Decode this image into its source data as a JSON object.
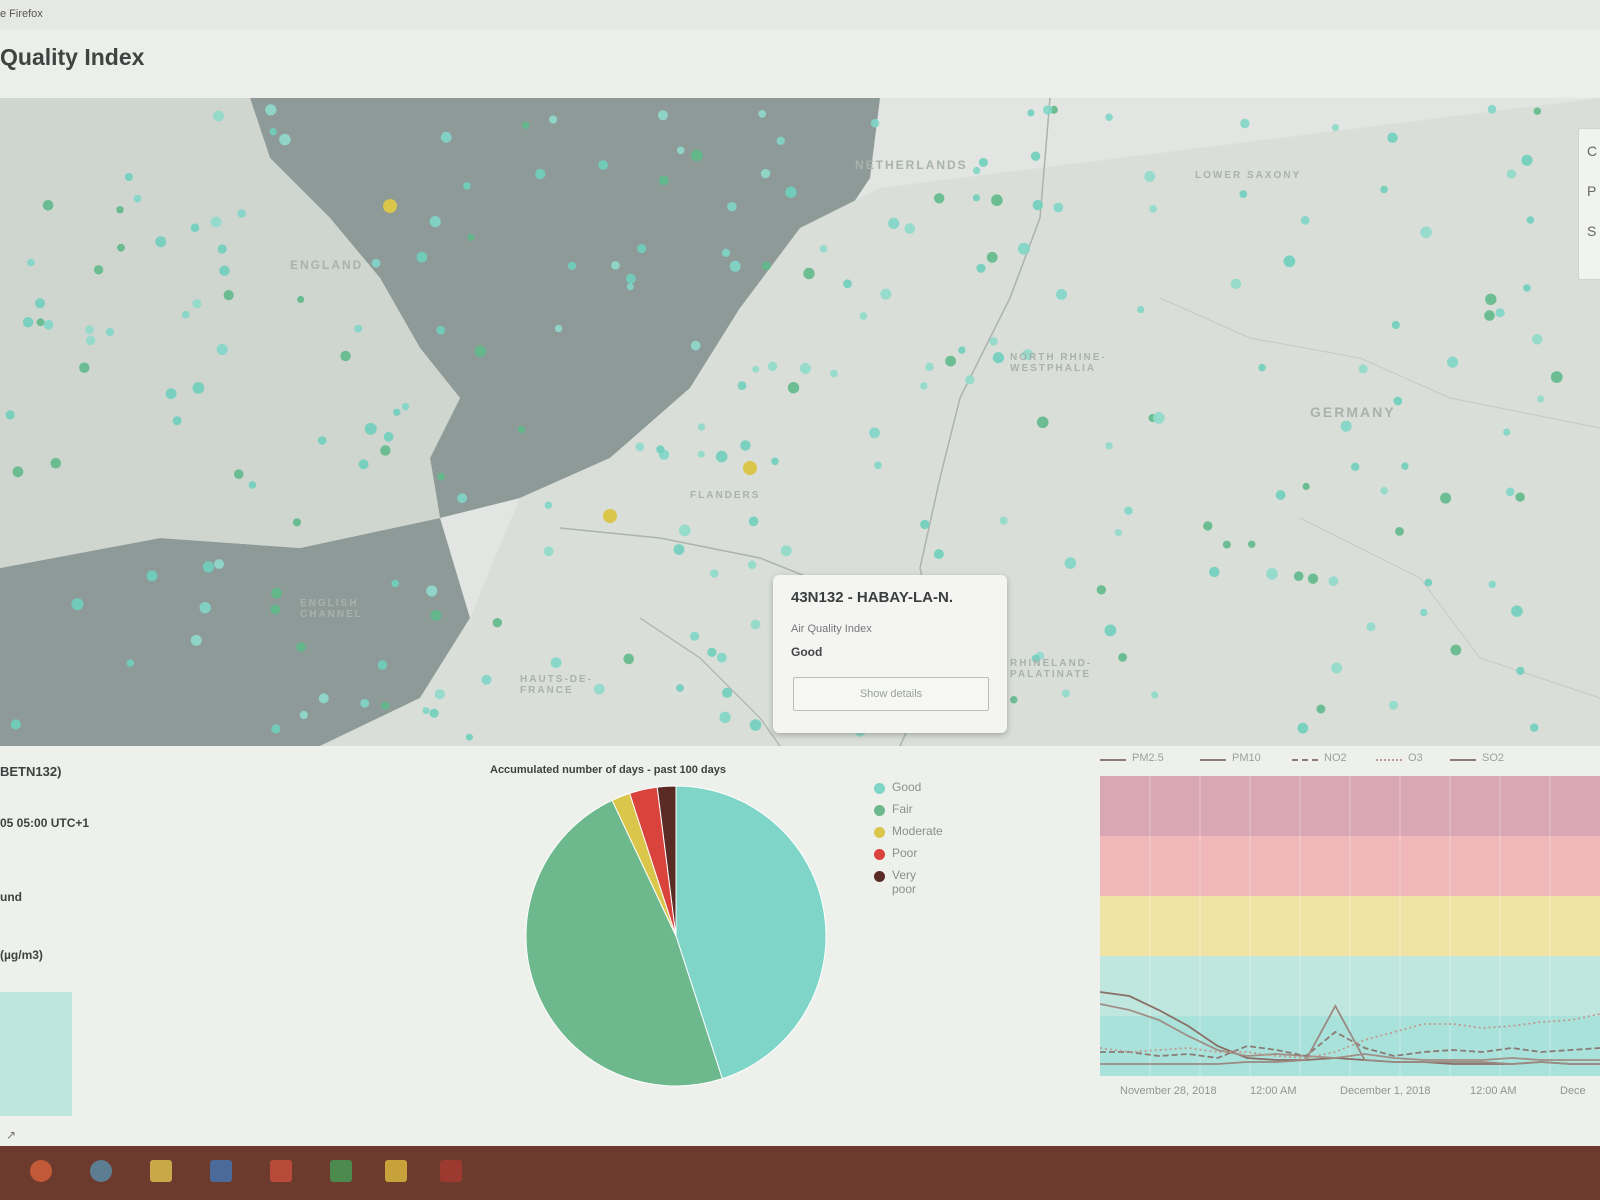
{
  "window": {
    "title": "e Firefox"
  },
  "page": {
    "title": "Quality Index"
  },
  "map": {
    "labels": {
      "netherlands": "NETHERLANDS",
      "england": "ENGLAND",
      "germany": "GERMANY",
      "north_rhine": "NORTH RHINE-WESTPHALIA",
      "flanders": "FLANDERS",
      "lower_saxony": "LOWER SAXONY",
      "hauts": "HAUTS-DE-FRANCE",
      "rhineland": "RHINELAND-PALATINATE",
      "english_channel": "ENGLISH CHANNEL"
    },
    "controls": [
      "C",
      "P",
      "S"
    ]
  },
  "popup": {
    "title": "43N132 - HABAY-LA-N.",
    "label": "Air Quality Index",
    "value": "Good",
    "button": "Show details"
  },
  "station": {
    "id_fragment": "BETN132)",
    "time_fragment": "05 05:00 UTC+1",
    "type_fragment": "und",
    "unit_fragment": "(µg/m3)"
  },
  "chart_data": [
    {
      "type": "pie",
      "title": "Accumulated number of days - past 100 days",
      "categories": [
        "Good",
        "Fair",
        "Moderate",
        "Poor",
        "Very poor"
      ],
      "values": [
        45,
        48,
        2,
        3,
        2
      ],
      "colors": [
        "#7fd6c8",
        "#6eb88e",
        "#d9c64a",
        "#d9433b",
        "#5a2a25"
      ],
      "legend_placement": "right"
    },
    {
      "type": "line",
      "series": [
        {
          "name": "PM2.5",
          "style": "solid",
          "color": "#8a6f66",
          "values": [
            42,
            40,
            33,
            25,
            15,
            9,
            8,
            8,
            9,
            8,
            7,
            7,
            6,
            6,
            6,
            7,
            6,
            6
          ]
        },
        {
          "name": "PM10",
          "style": "solid",
          "color": "#a08f86",
          "values": [
            36,
            33,
            28,
            20,
            13,
            10,
            11,
            10,
            9,
            11,
            9,
            8,
            8,
            8,
            9,
            8,
            8,
            8
          ]
        },
        {
          "name": "NO2",
          "style": "dashed",
          "color": "#8a7c75",
          "values": [
            12,
            12,
            10,
            11,
            9,
            15,
            13,
            10,
            22,
            14,
            10,
            12,
            13,
            12,
            14,
            12,
            13,
            14
          ]
        },
        {
          "name": "O3",
          "style": "dotted",
          "color": "#c09a8e",
          "values": [
            14,
            12,
            13,
            14,
            12,
            12,
            10,
            9,
            12,
            18,
            22,
            26,
            26,
            24,
            25,
            27,
            28,
            31
          ]
        },
        {
          "name": "SO2",
          "style": "solid",
          "color": "#9b8a82",
          "values": [
            6,
            6,
            6,
            6,
            6,
            7,
            7,
            8,
            35,
            8,
            7,
            7,
            7,
            7,
            6,
            7,
            6,
            6
          ]
        }
      ],
      "x_tick_labels": [
        "November 28, 2018",
        "12:00 AM",
        "December 1, 2018",
        "12:00 AM",
        "Dece"
      ],
      "ylim": [
        0,
        150
      ],
      "bands": [
        {
          "color": "#d9a7b3"
        },
        {
          "color": "#f0b8b8"
        },
        {
          "color": "#f0e3a4"
        },
        {
          "color": "#bfe6df"
        },
        {
          "color": "#a9e2db"
        }
      ],
      "legend_placement": "top"
    }
  ],
  "taskbar": {
    "icons": [
      "start-icon",
      "browser-icon",
      "folder-icon",
      "word-icon",
      "powerpoint-icon",
      "excel-icon",
      "lock-icon",
      "flag-icon"
    ]
  }
}
